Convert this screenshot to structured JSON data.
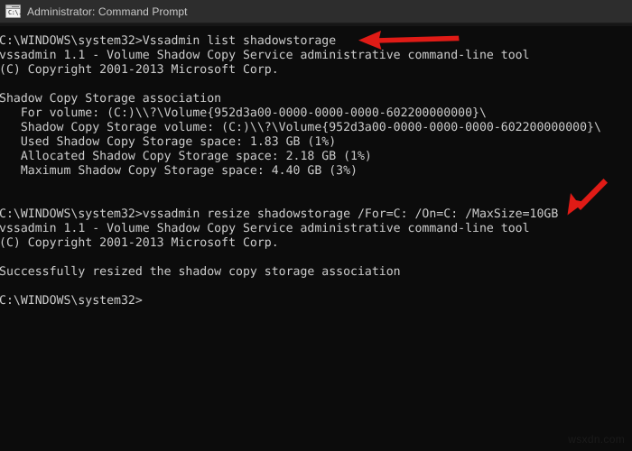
{
  "window": {
    "title": "Administrator: Command Prompt",
    "icon_name": "console-window-icon",
    "icon_glyph": "C:\\.",
    "titlebar_color": "#2d2d2d",
    "background_color": "#0c0c0c",
    "text_color": "#cccccc"
  },
  "console": {
    "lines": [
      "C:\\WINDOWS\\system32>Vssadmin list shadowstorage",
      "vssadmin 1.1 - Volume Shadow Copy Service administrative command-line tool",
      "(C) Copyright 2001-2013 Microsoft Corp.",
      "",
      "Shadow Copy Storage association",
      "   For volume: (C:)\\\\?\\Volume{952d3a00-0000-0000-0000-602200000000}\\",
      "   Shadow Copy Storage volume: (C:)\\\\?\\Volume{952d3a00-0000-0000-0000-602200000000}\\",
      "   Used Shadow Copy Storage space: 1.83 GB (1%)",
      "   Allocated Shadow Copy Storage space: 2.18 GB (1%)",
      "   Maximum Shadow Copy Storage space: 4.40 GB (3%)",
      "",
      "",
      "C:\\WINDOWS\\system32>vssadmin resize shadowstorage /For=C: /On=C: /MaxSize=10GB",
      "vssadmin 1.1 - Volume Shadow Copy Service administrative command-line tool",
      "(C) Copyright 2001-2013 Microsoft Corp.",
      "",
      "Successfully resized the shadow copy storage association",
      "",
      "C:\\WINDOWS\\system32>"
    ],
    "commands": [
      "Vssadmin list shadowstorage",
      "vssadmin resize shadowstorage /For=C: /On=C: /MaxSize=10GB"
    ],
    "prompt": "C:\\WINDOWS\\system32>",
    "values": {
      "version": "vssadmin 1.1",
      "copyright_years": "2001-2013",
      "used_storage": "1.83 GB",
      "used_storage_percent": "1%",
      "allocated_storage": "2.18 GB",
      "allocated_storage_percent": "1%",
      "maximum_storage": "4.40 GB",
      "maximum_storage_percent": "3%",
      "volume_guid": "952d3a00-0000-0000-0000-602200000000",
      "new_max_size": "10GB",
      "result": "Successfully resized the shadow copy storage association"
    }
  },
  "annotations": {
    "color": "#e01b16",
    "arrows": [
      {
        "name": "arrow-pointing-to-list-command",
        "direction": "left",
        "target": "Vssadmin list shadowstorage"
      },
      {
        "name": "arrow-pointing-to-resize-command",
        "direction": "down-left",
        "target": "/MaxSize=10GB"
      }
    ]
  },
  "watermark": {
    "text": "wsxdn.com"
  }
}
